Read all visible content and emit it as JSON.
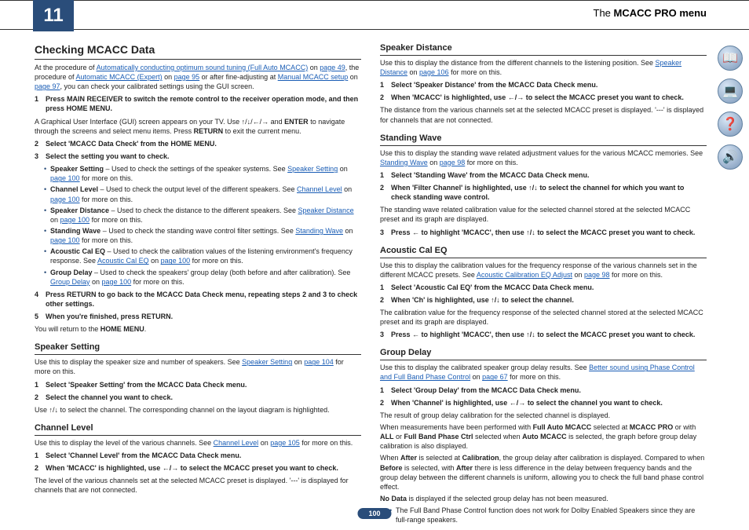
{
  "header": {
    "chapter": "11",
    "menu_prefix": "The",
    "menu_bold": "MCACC PRO menu"
  },
  "page_number": "100",
  "icons": [
    "book-icon",
    "screen-icon",
    "help-icon",
    "speaker-icon"
  ],
  "icon_glyphs": [
    "📖",
    "💻",
    "❓",
    "🔊"
  ],
  "left": {
    "h2": "Checking MCACC Data",
    "intro_a": "At the procedure of ",
    "intro_link1": "Automatically conducting optimum sound tuning (Full Auto MCACC)",
    "intro_b": " on ",
    "intro_link1p": "page 49",
    "intro_c": ", the procedure of ",
    "intro_link2": "Automatic MCACC (Expert)",
    "intro_d": " on ",
    "intro_link2p": "page 95",
    "intro_e": " or after fine-adjusting at ",
    "intro_link3": "Manual MCACC setup",
    "intro_f": " on ",
    "intro_link3p": "page 97",
    "intro_g": ", you can check your calibrated settings using the GUI screen.",
    "s1": "Press MAIN RECEIVER to switch the remote control to the receiver operation mode, and then press HOME MENU.",
    "s1desc_a": "A Graphical User Interface (GUI) screen appears on your TV. Use ",
    "s1desc_b": " and ",
    "s1desc_enter": "ENTER",
    "s1desc_c": " to navigate through the screens and select menu items. Press ",
    "s1desc_return": "RETURN",
    "s1desc_d": " to exit the current menu.",
    "s2": "Select 'MCACC Data Check' from the HOME MENU.",
    "s3": "Select the setting you want to check.",
    "bullets": [
      {
        "t": "Speaker Setting",
        "d": " – Used to check the settings of the speaker systems. See ",
        "l": "Speaker Setting",
        "p": "page 100",
        "e": " for more on this."
      },
      {
        "t": "Channel Level",
        "d": " – Used to check the output level of the different speakers. See ",
        "l": "Channel Level",
        "p": "page 100",
        "e": " for more on this."
      },
      {
        "t": "Speaker Distance",
        "d": " – Used to check the distance to the different speakers. See ",
        "l": "Speaker Distance",
        "p": "page 100",
        "e": " for more on this."
      },
      {
        "t": "Standing Wave",
        "d": " – Used to check the standing wave control filter settings. See ",
        "l": "Standing Wave",
        "p": "page 100",
        "e": " for more on this."
      },
      {
        "t": "Acoustic Cal EQ",
        "d": " – Used to check the calibration values of the listening environment's frequency response. See ",
        "l": "Acoustic Cal EQ",
        "p": "page 100",
        "e": " for more on this."
      },
      {
        "t": "Group Delay",
        "d": " – Used to check the speakers' group delay (both before and after calibration). See ",
        "l": "Group Delay",
        "p": "page 100",
        "e": " for more on this."
      }
    ],
    "s4": "Press RETURN to go back to the MCACC Data Check menu, repeating steps 2 and 3 to check other settings.",
    "s5": "When you're finished, press RETURN.",
    "s5desc_a": "You will return to the ",
    "s5desc_b": "HOME MENU",
    "s5desc_c": ".",
    "ss_h": "Speaker Setting",
    "ss_p_a": "Use this to display the speaker size and number of speakers. See ",
    "ss_p_l": "Speaker Setting",
    "ss_p_b": " on ",
    "ss_p_p": "page 104",
    "ss_p_c": " for more on this.",
    "ss_s1": "Select 'Speaker Setting' from the MCACC Data Check menu.",
    "ss_s2": "Select the channel you want to check.",
    "ss_s2d_a": "Use ",
    "ss_s2d_b": " to select the channel. The corresponding channel on the layout diagram is highlighted.",
    "cl_h": "Channel Level",
    "cl_p_a": "Use this to display the level of the various channels. See ",
    "cl_p_l": "Channel Level",
    "cl_p_b": " on ",
    "cl_p_p": "page 105",
    "cl_p_c": " for more on this.",
    "cl_s1": "Select 'Channel Level' from the MCACC Data Check menu.",
    "cl_s2_a": "When 'MCACC' is highlighted, use ",
    "cl_s2_b": " to select the MCACC preset you want to check.",
    "cl_s2d": "The level of the various channels set at the selected MCACC preset is displayed. '---' is displayed for channels that are not connected."
  },
  "right": {
    "sd_h": "Speaker Distance",
    "sd_p_a": "Use this to display the distance from the different channels to the listening position. See ",
    "sd_p_l": "Speaker Distance",
    "sd_p_b": " on ",
    "sd_p_p": "page 106",
    "sd_p_c": " for more on this.",
    "sd_s1": "Select 'Speaker Distance' from the MCACC Data Check menu.",
    "sd_s2_a": "When 'MCACC' is highlighted, use ",
    "sd_s2_b": " to select the MCACC preset you want to check.",
    "sd_s2d": "The distance from the various channels set at the selected MCACC preset is displayed. '---' is displayed for channels that are not connected.",
    "sw_h": "Standing Wave",
    "sw_p_a": "Use this to display the standing wave related adjustment values for the various MCACC memories. See ",
    "sw_p_l": "Standing Wave",
    "sw_p_b": " on ",
    "sw_p_p": "page 98",
    "sw_p_c": " for more on this.",
    "sw_s1": "Select 'Standing Wave' from the MCACC Data Check menu.",
    "sw_s2_a": "When 'Filter Channel' is highlighted, use ",
    "sw_s2_b": " to select the channel for which you want to check standing wave control.",
    "sw_s2d": "The standing wave related calibration value for the selected channel stored at the selected MCACC preset and its graph are displayed.",
    "sw_s3_a": "Press ",
    "sw_s3_b": " to highlight 'MCACC', then use ",
    "sw_s3_c": " to select the MCACC preset you want to check.",
    "ac_h": "Acoustic Cal EQ",
    "ac_p_a": "Use this to display the calibration values for the frequency response of the various channels set in the different MCACC presets. See ",
    "ac_p_l": "Acoustic Calibration EQ Adjust",
    "ac_p_b": " on ",
    "ac_p_p": "page 98",
    "ac_p_c": " for more on this.",
    "ac_s1": "Select 'Acoustic Cal EQ' from the MCACC Data Check menu.",
    "ac_s2_a": "When 'Ch' is highlighted, use ",
    "ac_s2_b": " to select the channel.",
    "ac_s2d": "The calibration value for the frequency response of the selected channel stored at the selected MCACC preset and its graph are displayed.",
    "ac_s3_a": "Press ",
    "ac_s3_b": " to highlight 'MCACC', then use ",
    "ac_s3_c": " to select the MCACC preset you want to check.",
    "gd_h": "Group Delay",
    "gd_p_a": "Use this to display the calibrated speaker group delay results. See ",
    "gd_p_l": "Better sound using Phase Control and Full Band Phase Control",
    "gd_p_b": " on ",
    "gd_p_p": "page 67",
    "gd_p_c": " for more on this.",
    "gd_s1": "Select 'Group Delay' from the MCACC Data Check menu.",
    "gd_s2_a": "When 'Channel' is highlighted, use ",
    "gd_s2_b": " to select the channel you want to check.",
    "gd_d1": "The result of group delay calibration for the selected channel is displayed.",
    "gd_d2_a": "When measurements have been performed with ",
    "gd_d2_b": "Full Auto MCACC",
    "gd_d2_c": " selected at ",
    "gd_d2_d": "MCACC PRO",
    "gd_d2_e": " or with ",
    "gd_d2_f": "ALL",
    "gd_d2_g": " or ",
    "gd_d2_h": "Full Band Phase Ctrl",
    "gd_d2_i": " selected when ",
    "gd_d2_j": "Auto MCACC",
    "gd_d2_k": " is selected, the graph before group delay calibration is also displayed.",
    "gd_d3_a": "When ",
    "gd_d3_b": "After",
    "gd_d3_c": " is selected at ",
    "gd_d3_d": "Calibration",
    "gd_d3_e": ", the group delay after calibration is displayed. Compared to when ",
    "gd_d3_f": "Before",
    "gd_d3_g": " is selected, with ",
    "gd_d3_h": "After",
    "gd_d3_i": " there is less difference in the delay between frequency bands and the group delay between the different channels is uniform, allowing you to check the full band phase control effect.",
    "gd_d4_a": "No Data",
    "gd_d4_b": " is displayed if the selected group delay has not been measured.",
    "gd_note": "The Full Band Phase Control function does not work for Dolby Enabled Speakers since they are full-range speakers."
  },
  "arrows": {
    "updown": "↑/↓",
    "leftright": "←/→",
    "all": "↑/↓/←/→",
    "left": "←"
  }
}
